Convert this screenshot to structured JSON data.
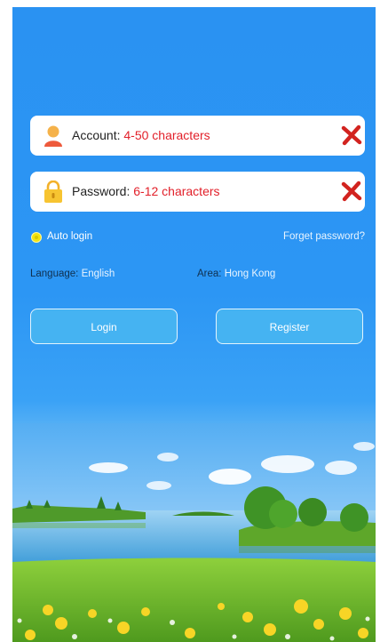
{
  "account": {
    "label": "Account:",
    "hint": "4-50 characters"
  },
  "password": {
    "label": "Password:",
    "hint": "6-12 characters"
  },
  "auto_login": {
    "label": "Auto login"
  },
  "forget_password": {
    "label": "Forget password?"
  },
  "language": {
    "label": "Language:",
    "value": "English"
  },
  "area": {
    "label": "Area:",
    "value": "Hong Kong"
  },
  "buttons": {
    "login": "Login",
    "register": "Register"
  },
  "icons": {
    "account": "person-icon",
    "password": "lock-icon",
    "clear": "close-icon",
    "auto_login": "radio-selected-icon"
  },
  "colors": {
    "background": "#2c96f4",
    "hint": "#e2202a",
    "button": "#45b3f2",
    "clear": "#d2231f"
  }
}
